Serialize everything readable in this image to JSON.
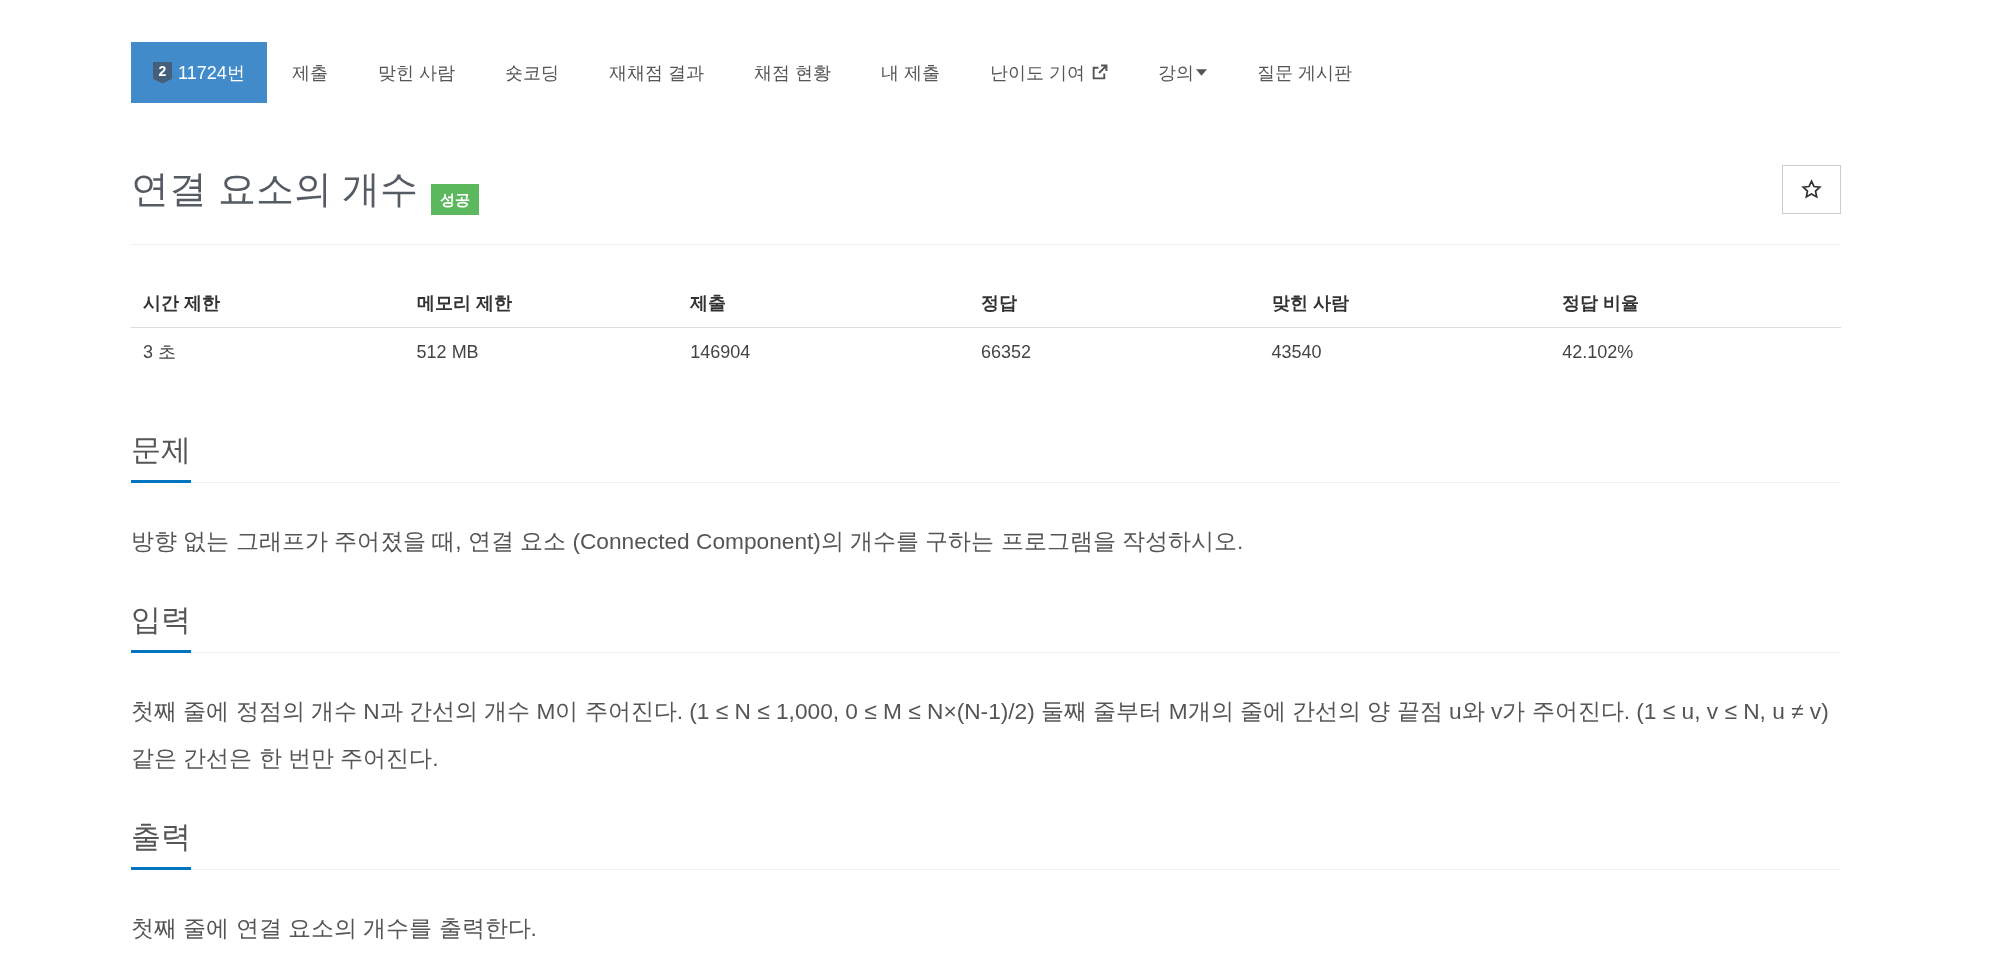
{
  "nav": {
    "items": [
      {
        "kind": "problem",
        "label": "11724번",
        "tier": "2",
        "selected": true
      },
      {
        "kind": "link",
        "label": "제출",
        "selected": false
      },
      {
        "kind": "link",
        "label": "맞힌 사람",
        "selected": false
      },
      {
        "kind": "link",
        "label": "숏코딩",
        "selected": false
      },
      {
        "kind": "link",
        "label": "재채점 결과",
        "selected": false
      },
      {
        "kind": "link",
        "label": "채점 현황",
        "selected": false
      },
      {
        "kind": "link",
        "label": "내 제출",
        "selected": false
      },
      {
        "kind": "external",
        "label": "난이도 기여",
        "selected": false
      },
      {
        "kind": "dropdown",
        "label": "강의",
        "selected": false
      },
      {
        "kind": "link",
        "label": "질문 게시판",
        "selected": false
      }
    ]
  },
  "problem": {
    "title": "연결 요소의 개수",
    "result_label": "성공",
    "starred": false
  },
  "info_table": {
    "columns": [
      "시간 제한",
      "메모리 제한",
      "제출",
      "정답",
      "맞힌 사람",
      "정답 비율"
    ],
    "rows": [
      [
        "3 초",
        "512 MB",
        "146904",
        "66352",
        "43540",
        "42.102%"
      ]
    ]
  },
  "sections": [
    {
      "heading": "문제",
      "text": "방향 없는 그래프가 주어졌을 때, 연결 요소 (Connected Component)의 개수를 구하는 프로그램을 작성하시오."
    },
    {
      "heading": "입력",
      "text": "첫째 줄에 정점의 개수 N과 간선의 개수 M이 주어진다. (1 ≤ N ≤ 1,000, 0 ≤ M ≤ N×(N-1)/2) 둘째 줄부터 M개의 줄에 간선의 양 끝점 u와 v가 주어진다. (1 ≤ u, v ≤ N, u ≠ v) 같은 간선은 한 번만 주어진다."
    },
    {
      "heading": "출력",
      "text": "첫째 줄에 연결 요소의 개수를 출력한다."
    }
  ]
}
